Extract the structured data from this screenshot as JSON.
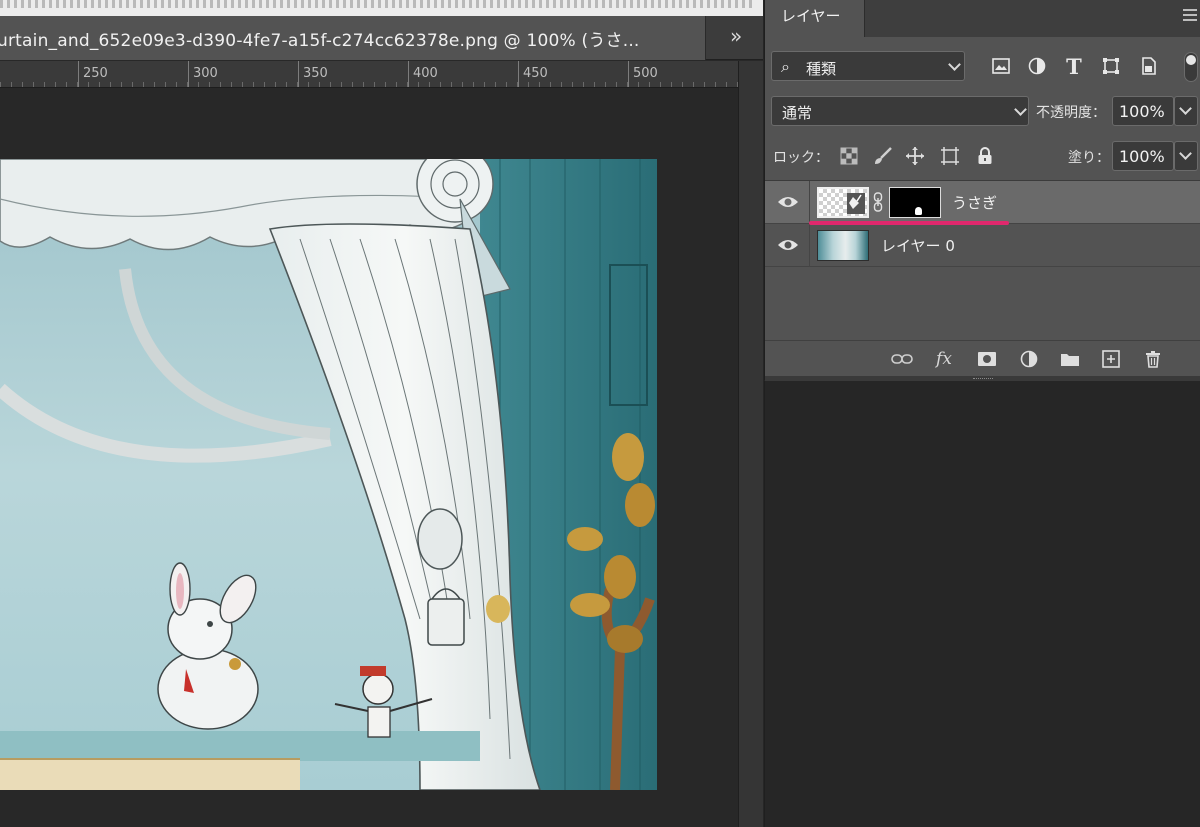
{
  "document": {
    "tab_title": "urtain_and_652e09e3-d390-4fe7-a15f-c274cc62378e.png @ 100% (うさ...",
    "overflow_icon": "double-chevron-right",
    "ruler_labels": [
      "250",
      "300",
      "350",
      "400",
      "450",
      "500"
    ]
  },
  "layers_panel": {
    "tab_label": "レイヤー",
    "menu_icon": "hamburger",
    "filter": {
      "label": "種類",
      "icon": "search"
    },
    "filter_icons": [
      "image-filter",
      "adjustment-filter",
      "type-filter",
      "shape-filter",
      "smart-object-filter"
    ],
    "blend_mode": "通常",
    "opacity_label": "不透明度：",
    "opacity_value": "100%",
    "lock_label": "ロック：",
    "lock_icons": [
      "lock-transparent-pixels",
      "lock-image-pixels",
      "lock-position",
      "lock-artboard",
      "lock-all"
    ],
    "fill_label": "塗り：",
    "fill_value": "100%",
    "layers": [
      {
        "name": "うさぎ",
        "visible": true,
        "selected": true,
        "has_mask": true
      },
      {
        "name": "レイヤー 0",
        "visible": true,
        "selected": false,
        "has_mask": false
      }
    ],
    "footer_icons": [
      "link-layers",
      "fx-styles",
      "add-mask",
      "adjustment-layer",
      "new-group",
      "new-layer",
      "delete-layer"
    ],
    "footer_fx_label": "fx",
    "highlight_color": "#e0286d"
  }
}
